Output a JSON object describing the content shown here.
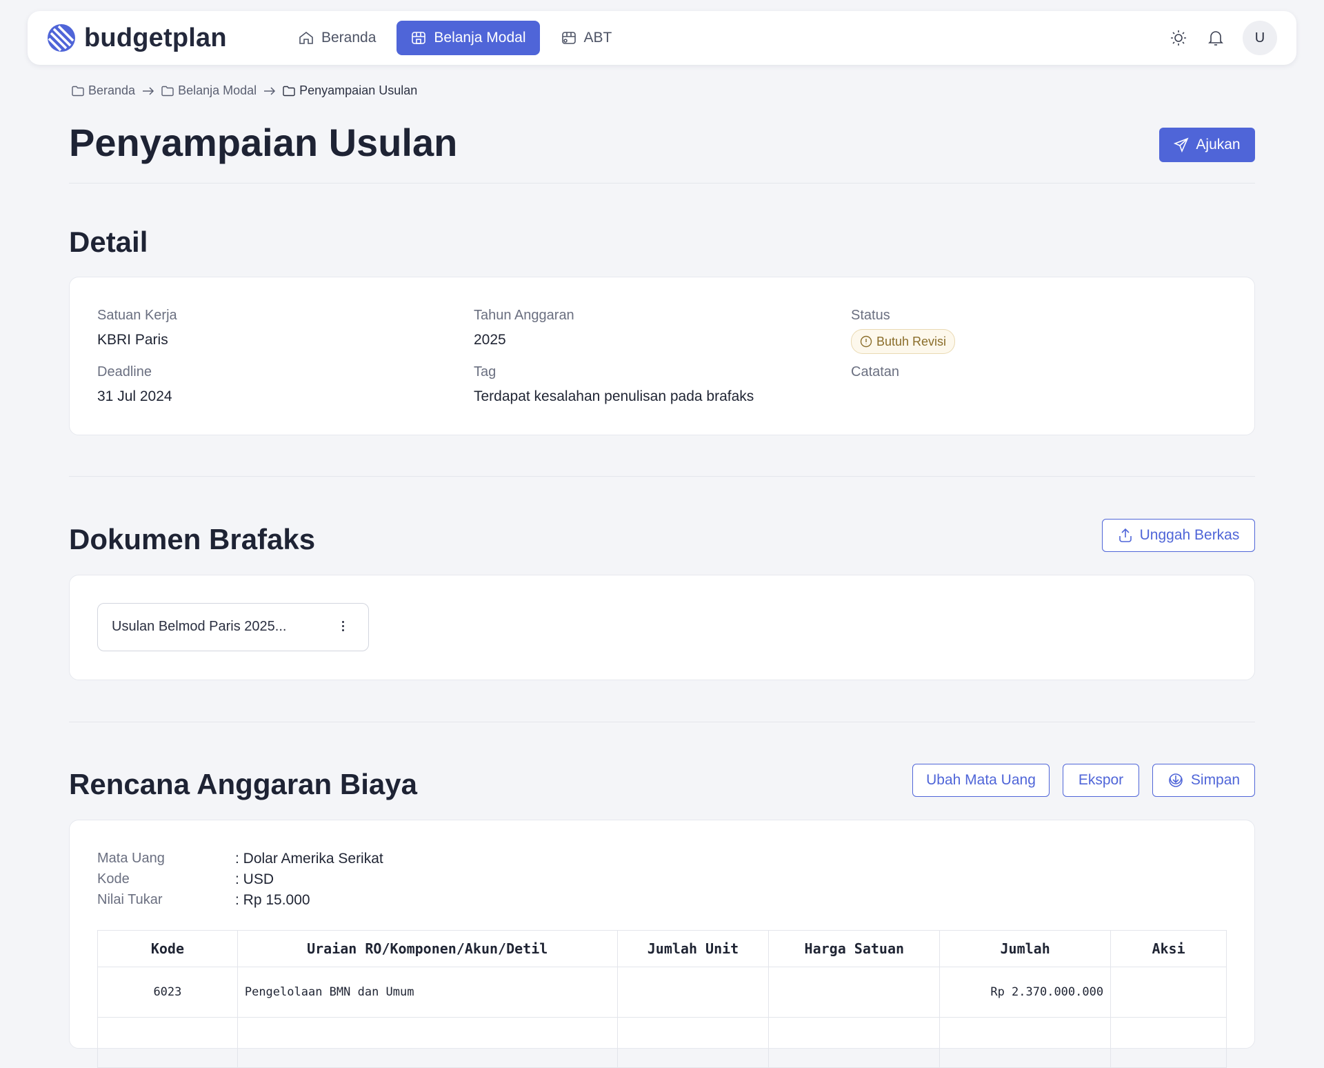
{
  "app": {
    "name": "budgetplan"
  },
  "nav": {
    "items": [
      {
        "label": "Beranda",
        "icon": "home-icon",
        "active": false
      },
      {
        "label": "Belanja Modal",
        "icon": "store-icon",
        "active": true
      },
      {
        "label": "ABT",
        "icon": "store-icon",
        "active": false
      }
    ]
  },
  "header": {
    "avatar_initial": "U"
  },
  "breadcrumb": [
    "Beranda",
    "Belanja Modal",
    "Penyampaian Usulan"
  ],
  "page": {
    "title": "Penyampaian Usulan",
    "submit_label": "Ajukan"
  },
  "detail": {
    "title": "Detail",
    "satuan_kerja_label": "Satuan Kerja",
    "satuan_kerja_value": "KBRI Paris",
    "tahun_label": "Tahun Anggaran",
    "tahun_value": "2025",
    "status_label": "Status",
    "status_value": "Butuh Revisi",
    "deadline_label": "Deadline",
    "deadline_value": "31 Jul 2024",
    "tag_label": "Tag",
    "tag_value": "Terdapat kesalahan penulisan pada brafaks",
    "catatan_label": "Catatan"
  },
  "dokumen": {
    "title": "Dokumen Brafaks",
    "upload_label": "Unggah Berkas",
    "files": [
      {
        "name": "Usulan Belmod Paris 2025..."
      }
    ]
  },
  "rab": {
    "title": "Rencana Anggaran Biaya",
    "actions": {
      "change_currency": "Ubah Mata Uang",
      "export": "Ekspor",
      "save": "Simpan"
    },
    "meta": [
      {
        "label": "Mata Uang",
        "value": ": Dolar Amerika Serikat"
      },
      {
        "label": "Kode",
        "value": ": USD"
      },
      {
        "label": "Nilai Tukar",
        "value": ": Rp 15.000"
      }
    ],
    "columns": [
      "Kode",
      "Uraian RO/Komponen/Akun/Detil",
      "Jumlah Unit",
      "Harga Satuan",
      "Jumlah",
      "Aksi"
    ],
    "rows": [
      {
        "kode": "6023",
        "uraian": "Pengelolaan BMN dan Umum",
        "jumlah_unit": "",
        "harga_satuan": "",
        "jumlah": "Rp 2.370.000.000",
        "aksi": ""
      },
      {
        "kode": "",
        "uraian": "",
        "jumlah_unit": "",
        "harga_satuan": "",
        "jumlah": "",
        "aksi": ""
      }
    ]
  },
  "colors": {
    "primary": "#4f65d8",
    "background": "#f4f5f8",
    "badge_warning": "#8a6d2a"
  }
}
